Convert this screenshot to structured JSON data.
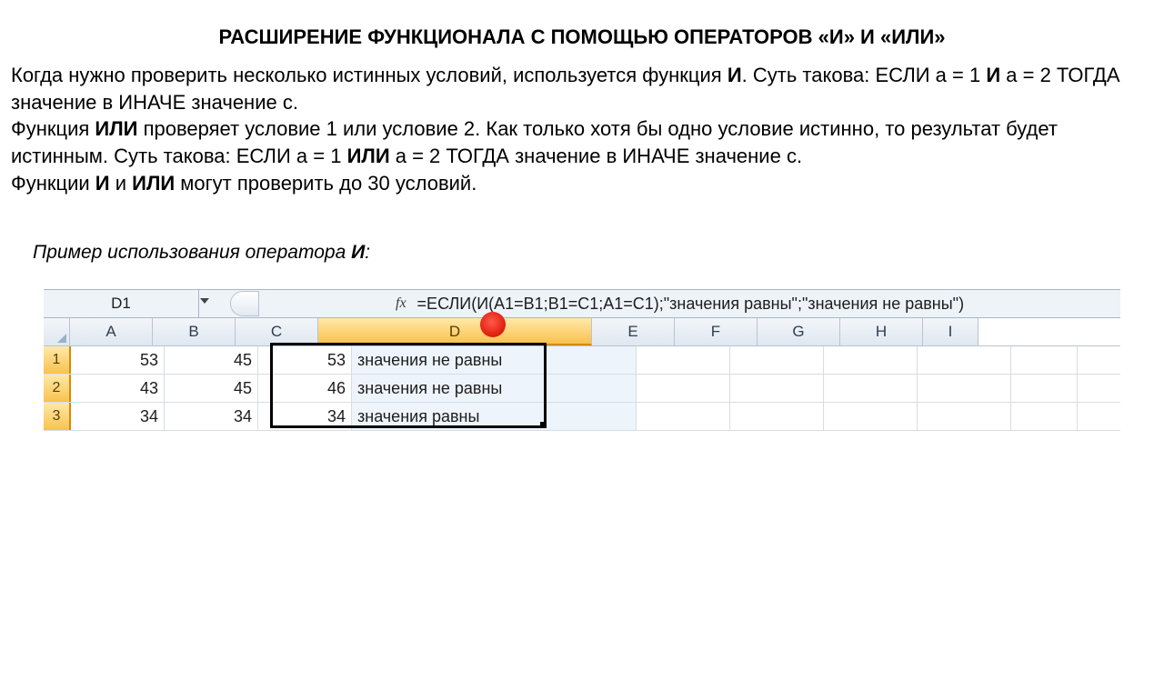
{
  "title": "РАСШИРЕНИЕ ФУНКЦИОНАЛА С ПОМОЩЬЮ ОПЕРАТОРОВ «И» И «ИЛИ»",
  "para": {
    "p1a": "Когда нужно проверить несколько истинных условий, используется функция ",
    "p1b": "И",
    "p1c": ". Суть такова: ЕСЛИ а = 1 ",
    "p1d": "И",
    "p1e": " а = 2 ТОГДА значение в ИНАЧЕ значение с.",
    "p2a": "Функция ",
    "p2b": "ИЛИ",
    "p2c": " проверяет условие 1 или условие 2. Как только хотя бы одно условие истинно, то результат будет истинным. Суть такова: ЕСЛИ а = 1 ",
    "p2d": "ИЛИ",
    "p2e": " а = 2 ТОГДА значение в ИНАЧЕ значение с.",
    "p3a": "Функции ",
    "p3b": "И",
    "p3c": " и ",
    "p3d": "ИЛИ",
    "p3e": " могут проверить до 30 условий."
  },
  "example": {
    "prefix": "Пример использования оператора ",
    "op": "И",
    "suffix": ":"
  },
  "excel": {
    "name_box": "D1",
    "fx_label": "fx",
    "formula": "=ЕСЛИ(И(A1=B1;B1=C1;A1=C1);\"значения равны\";\"значения не равны\")",
    "cols": [
      "A",
      "B",
      "C",
      "D",
      "E",
      "F",
      "G",
      "H",
      "I"
    ],
    "wide_col_index": 3,
    "selected_col_index": 3,
    "rows": [
      {
        "n": "1",
        "cells": [
          "53",
          "45",
          "53",
          "значения не равны",
          "",
          "",
          "",
          "",
          ""
        ]
      },
      {
        "n": "2",
        "cells": [
          "43",
          "45",
          "46",
          "значения не равны",
          "",
          "",
          "",
          "",
          ""
        ]
      },
      {
        "n": "3",
        "cells": [
          "34",
          "34",
          "34",
          "значения равны",
          "",
          "",
          "",
          "",
          ""
        ]
      }
    ]
  }
}
